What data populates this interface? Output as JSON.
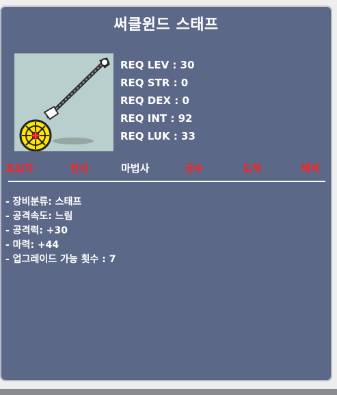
{
  "item": {
    "name": "써클윈드 스태프",
    "icon": "staff-icon"
  },
  "requirements": [
    "REQ LEV : 30",
    "REQ STR : 0",
    "REQ DEX : 0",
    "REQ INT : 92",
    "REQ LUK : 33"
  ],
  "jobs": [
    {
      "name": "초보자",
      "color": "#ff2121"
    },
    {
      "name": "전사",
      "color": "#ff2121"
    },
    {
      "name": "마법사",
      "color": "#ffffff"
    },
    {
      "name": "궁수",
      "color": "#ff2121"
    },
    {
      "name": "도적",
      "color": "#ff2121"
    },
    {
      "name": "해적",
      "color": "#ff2121"
    }
  ],
  "stats": [
    "- 장비분류: 스태프",
    "- 공격속도: 느림",
    "- 공격력: +30",
    "- 마력: +44",
    "- 업그레이드 가능 횟수 : 7"
  ],
  "colors": {
    "panel_bg": "#5c6887",
    "image_bg": "#b9cfcd",
    "job_unavailable": "#ff2121",
    "job_available": "#ffffff"
  }
}
